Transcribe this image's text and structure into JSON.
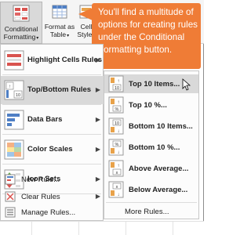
{
  "ribbon": {
    "conditional_formatting": [
      "Conditional",
      "Formatting"
    ],
    "format_as_table": [
      "Format as",
      "Table"
    ],
    "cell_styles": [
      "Cell",
      "Styles"
    ],
    "caret": "▾"
  },
  "callout": {
    "text": "You'll find a multitude of options for creating rules under the Conditional Formatting button."
  },
  "menu": {
    "items": [
      {
        "label": "Highlight Cells Rules",
        "icon": "highlight-cells-icon",
        "active": false
      },
      {
        "label": "Top/Bottom Rules",
        "icon": "top-bottom-icon",
        "active": true
      },
      {
        "label": "Data Bars",
        "icon": "data-bars-icon",
        "active": false
      },
      {
        "label": "Color Scales",
        "icon": "color-scales-icon",
        "active": false
      },
      {
        "label": "Icon Sets",
        "icon": "icon-sets-icon",
        "active": false
      }
    ],
    "small_items": [
      {
        "label": "New Rule...",
        "icon": "new-rule-icon",
        "has_arrow": false
      },
      {
        "label": "Clear Rules",
        "icon": "clear-rules-icon",
        "has_arrow": true
      },
      {
        "label": "Manage Rules...",
        "icon": "manage-rules-icon",
        "has_arrow": false
      }
    ],
    "arrow": "▶"
  },
  "submenu": {
    "items": [
      {
        "label": "Top 10 Items...",
        "icon": "top-10-icon",
        "badge": "10",
        "active": true
      },
      {
        "label": "Top 10 %...",
        "icon": "top-10-percent-icon",
        "badge": "%",
        "active": false
      },
      {
        "label": "Bottom 10 Items...",
        "icon": "bottom-10-icon",
        "badge": "10",
        "active": false
      },
      {
        "label": "Bottom 10 %...",
        "icon": "bottom-10-percent-icon",
        "badge": "%",
        "active": false
      },
      {
        "label": "Above Average...",
        "icon": "above-average-icon",
        "badge": "x",
        "active": false
      },
      {
        "label": "Below Average...",
        "icon": "below-average-icon",
        "badge": "x",
        "active": false
      }
    ],
    "more_rules": "More Rules..."
  },
  "colors": {
    "callout": "#ef7c36",
    "highlight": "#d9d9d9",
    "accent_orange": "#e8a24a",
    "accent_blue": "#4f7fc4",
    "accent_red": "#d9534f",
    "accent_green": "#6aa84f"
  }
}
